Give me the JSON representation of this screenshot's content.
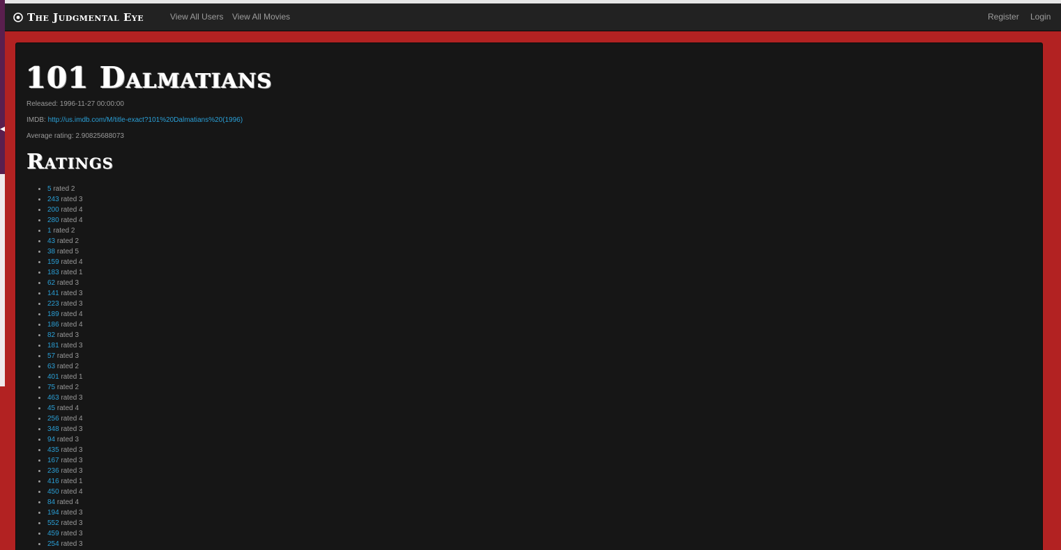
{
  "navbar": {
    "brand": "The Judgmental Eye",
    "brand_icon": "eye-icon",
    "links": {
      "users": "View All Users",
      "movies": "View All Movies",
      "register": "Register",
      "login": "Login"
    }
  },
  "movie": {
    "title": "101 Dalmatians",
    "released_label": "Released:",
    "released_value": "1996-11-27 00:00:00",
    "imdb_label": "IMDB:",
    "imdb_url": "http://us.imdb.com/M/title-exact?101%20Dalmatians%20(1996)",
    "avg_label": "Average rating:",
    "avg_value": "2.90825688073"
  },
  "ratings": {
    "heading": "Ratings",
    "word": "rated",
    "items": [
      {
        "user": "5",
        "score": "2"
      },
      {
        "user": "243",
        "score": "3"
      },
      {
        "user": "200",
        "score": "4"
      },
      {
        "user": "280",
        "score": "4"
      },
      {
        "user": "1",
        "score": "2"
      },
      {
        "user": "43",
        "score": "2"
      },
      {
        "user": "38",
        "score": "5"
      },
      {
        "user": "159",
        "score": "4"
      },
      {
        "user": "183",
        "score": "1"
      },
      {
        "user": "62",
        "score": "3"
      },
      {
        "user": "141",
        "score": "3"
      },
      {
        "user": "223",
        "score": "3"
      },
      {
        "user": "189",
        "score": "4"
      },
      {
        "user": "186",
        "score": "4"
      },
      {
        "user": "82",
        "score": "3"
      },
      {
        "user": "181",
        "score": "3"
      },
      {
        "user": "57",
        "score": "3"
      },
      {
        "user": "63",
        "score": "2"
      },
      {
        "user": "401",
        "score": "1"
      },
      {
        "user": "75",
        "score": "2"
      },
      {
        "user": "463",
        "score": "3"
      },
      {
        "user": "45",
        "score": "4"
      },
      {
        "user": "256",
        "score": "4"
      },
      {
        "user": "348",
        "score": "3"
      },
      {
        "user": "94",
        "score": "3"
      },
      {
        "user": "435",
        "score": "3"
      },
      {
        "user": "167",
        "score": "3"
      },
      {
        "user": "236",
        "score": "3"
      },
      {
        "user": "416",
        "score": "1"
      },
      {
        "user": "450",
        "score": "4"
      },
      {
        "user": "84",
        "score": "4"
      },
      {
        "user": "194",
        "score": "3"
      },
      {
        "user": "552",
        "score": "3"
      },
      {
        "user": "459",
        "score": "3"
      },
      {
        "user": "254",
        "score": "3"
      }
    ]
  },
  "colors": {
    "page_background": "#b22222",
    "navbar_background": "#222222",
    "panel_background": "#161616",
    "link": "#2a9fd6",
    "muted_text": "#9a9a9a"
  }
}
